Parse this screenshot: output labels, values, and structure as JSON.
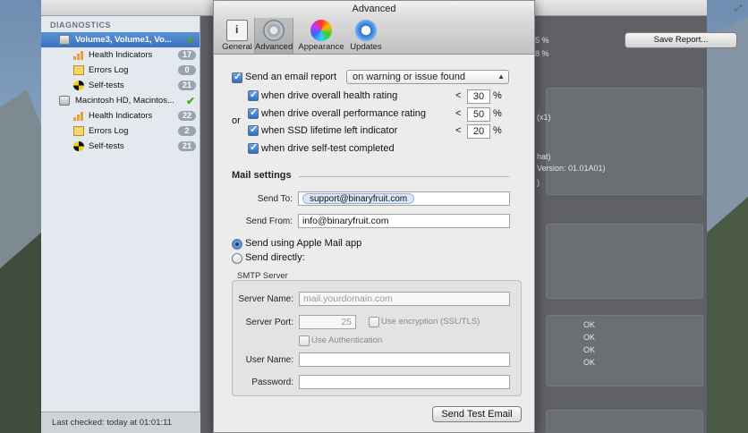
{
  "main_window": {
    "sidebar_header": "DIAGNOSTICS",
    "sidebar_items": [
      {
        "label": "Volume3, Volume1, Vo...",
        "type": "disk",
        "selected": true,
        "check": "✔"
      },
      {
        "label": "Health Indicators",
        "type": "bars",
        "badge": "17"
      },
      {
        "label": "Errors Log",
        "type": "log",
        "badge": "0"
      },
      {
        "label": "Self-tests",
        "type": "test",
        "badge": "21"
      },
      {
        "label": "Macintosh HD, Macintos...",
        "type": "disk",
        "check": "✔"
      },
      {
        "label": "Health Indicators",
        "type": "bars",
        "badge": "22"
      },
      {
        "label": "Errors Log",
        "type": "log",
        "badge": "2"
      },
      {
        "label": "Self-tests",
        "type": "test",
        "badge": "21"
      }
    ],
    "status": "Last checked: today at 01:01:11",
    "save_report": "Save Report...",
    "right_fragments": [
      "5 %",
      "8 %",
      "(x1)",
      "hat)",
      "Version: 01.01A01)",
      ")",
      "OK",
      "OK",
      "OK",
      "OK"
    ]
  },
  "dialog": {
    "title": "Advanced",
    "tabs": [
      {
        "label": "General",
        "icon": "general-icon"
      },
      {
        "label": "Advanced",
        "icon": "gear-icon",
        "active": true
      },
      {
        "label": "Appearance",
        "icon": "color-wheel-icon"
      },
      {
        "label": "Updates",
        "icon": "updates-icon"
      }
    ],
    "email_report_label": "Send an email report",
    "email_report_option": "on warning or issue found",
    "or_label": "or",
    "conditions": [
      {
        "label": "when drive overall health rating",
        "op": "<",
        "value": "30",
        "unit": "%"
      },
      {
        "label": "when drive overall performance rating",
        "op": "<",
        "value": "50",
        "unit": "%"
      },
      {
        "label": "when SSD lifetime left indicator",
        "op": "<",
        "value": "20",
        "unit": "%"
      },
      {
        "label": "when drive self-test completed"
      }
    ],
    "mail_settings_title": "Mail settings",
    "send_to_label": "Send To:",
    "send_to_token": "support@binaryfruit.com",
    "send_from_label": "Send From:",
    "send_from_value": "info@binaryfruit.com",
    "radio_apple_mail": "Send using Apple Mail app",
    "radio_direct": "Send directly:",
    "smtp_title": "SMTP Server",
    "server_name_label": "Server Name:",
    "server_name_placeholder": "mail.yourdomain.com",
    "server_port_label": "Server Port:",
    "server_port_value": "25",
    "use_encryption_label": "Use encryption (SSL/TLS)",
    "use_auth_label": "Use Authentication",
    "user_name_label": "User Name:",
    "password_label": "Password:",
    "send_test_button": "Send Test Email"
  }
}
